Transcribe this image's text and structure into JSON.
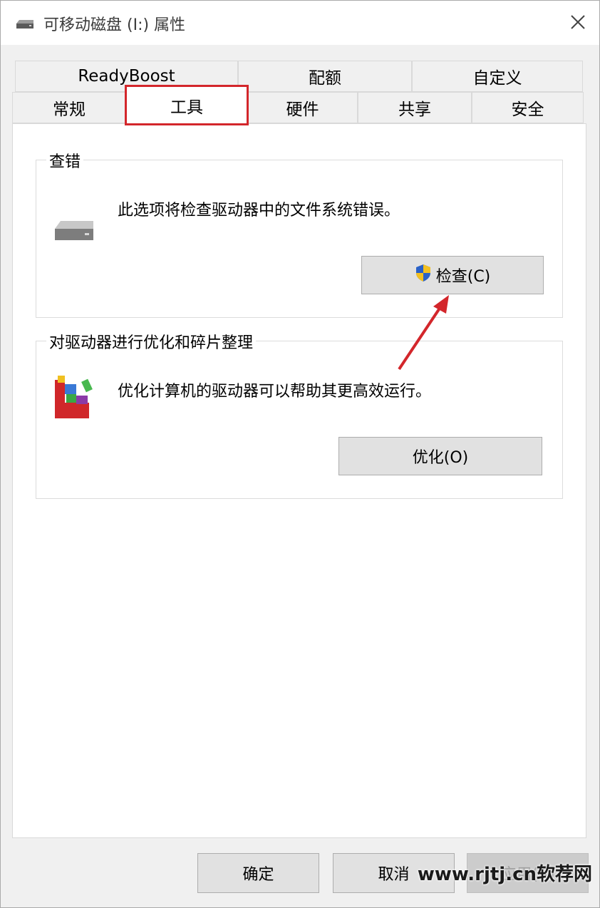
{
  "window": {
    "title": "可移动磁盘 (I:) 属性",
    "title_icon": "drive-icon",
    "close_icon": "close-icon"
  },
  "tabs": {
    "row1": [
      {
        "label": "ReadyBoost"
      },
      {
        "label": "配额"
      },
      {
        "label": "自定义"
      }
    ],
    "row2": [
      {
        "label": "常规"
      },
      {
        "label": "工具",
        "active": true
      },
      {
        "label": "硬件"
      },
      {
        "label": "共享"
      },
      {
        "label": "安全"
      }
    ]
  },
  "error_check": {
    "title": "查错",
    "description": "此选项将检查驱动器中的文件系统错误。",
    "button_label": "检查(C)",
    "icon": "removable-drive-icon",
    "button_icon": "uac-shield-icon"
  },
  "optimize": {
    "title": "对驱动器进行优化和碎片整理",
    "description": "优化计算机的驱动器可以帮助其更高效运行。",
    "button_label": "优化(O)",
    "icon": "defrag-icon"
  },
  "footer": {
    "ok_label": "确定",
    "cancel_label": "取消",
    "apply_label": "应用(A)"
  },
  "watermark": "www.rjtj.cn软荐网",
  "colors": {
    "highlight": "#d3262b",
    "window_bg": "#f0f0f0",
    "button_bg": "#e1e1e1"
  }
}
